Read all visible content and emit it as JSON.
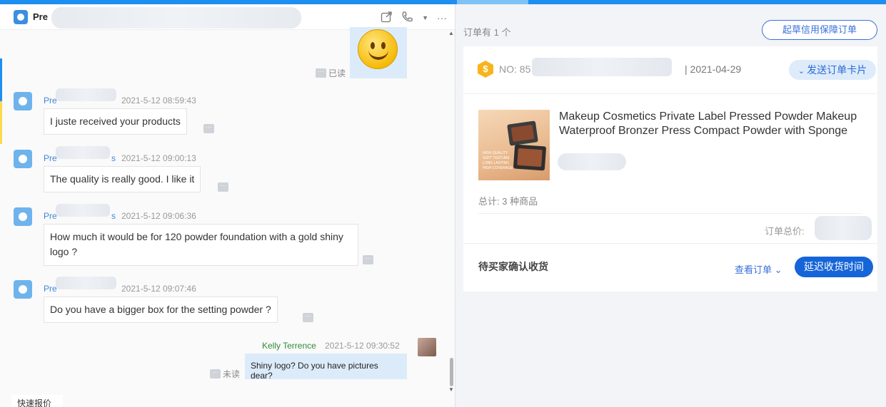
{
  "chat": {
    "header": {
      "name": "Pre",
      "icons": [
        "share-icon",
        "phone-icon",
        "dropdown-icon",
        "more-icon"
      ]
    },
    "emoji_read": "已读",
    "messages": [
      {
        "sender": "Pre",
        "time": "2021-5-12 08:59:43",
        "text": "I juste received your products"
      },
      {
        "sender": "Pre",
        "sender_suffix": "s",
        "time": "2021-5-12 09:00:13",
        "text": "The quality is really good. I like it"
      },
      {
        "sender": "Pre",
        "sender_suffix": "s",
        "time": "2021-5-12 09:06:36",
        "text": "How much it would be for 120 powder foundation with a gold shiny logo ?"
      },
      {
        "sender": "Pre",
        "time": "2021-5-12 09:07:46",
        "text": "Do you have a bigger box for the setting powder ?"
      }
    ],
    "my_message": {
      "sender": "Kelly Terrence",
      "time": "2021-5-12 09:30:52",
      "text": "Shiny logo? Do you have pictures dear?",
      "status": "未读"
    },
    "quick_quote_tab": "快速报价"
  },
  "orders": {
    "count_label": "订单有 1 个",
    "guarantee_button": "起草信用保障订单",
    "card": {
      "no_prefix": "NO: 85",
      "date": "| 2021-04-29",
      "send_card_button": "发送订单卡片",
      "product_title": "Makeup Cosmetics Private Label Pressed Powder Makeup Waterproof Bronzer Press Compact Powder with Sponge",
      "image_text": "HIGH QUALITY\nSOFT TEXTURE\nLONG LASTING\nHIGH COVERAGE",
      "total_items": "总计: 3 种商品",
      "total_price_label": "订单总价:",
      "status": "待买家确认收货",
      "view_order": "查看订单",
      "delay_button": "延迟收货时间"
    }
  },
  "colors": {
    "accent": "#1e8ff0",
    "primary_button": "#1565d8",
    "link": "#3a6fd9",
    "my_name": "#2e8b3a"
  }
}
